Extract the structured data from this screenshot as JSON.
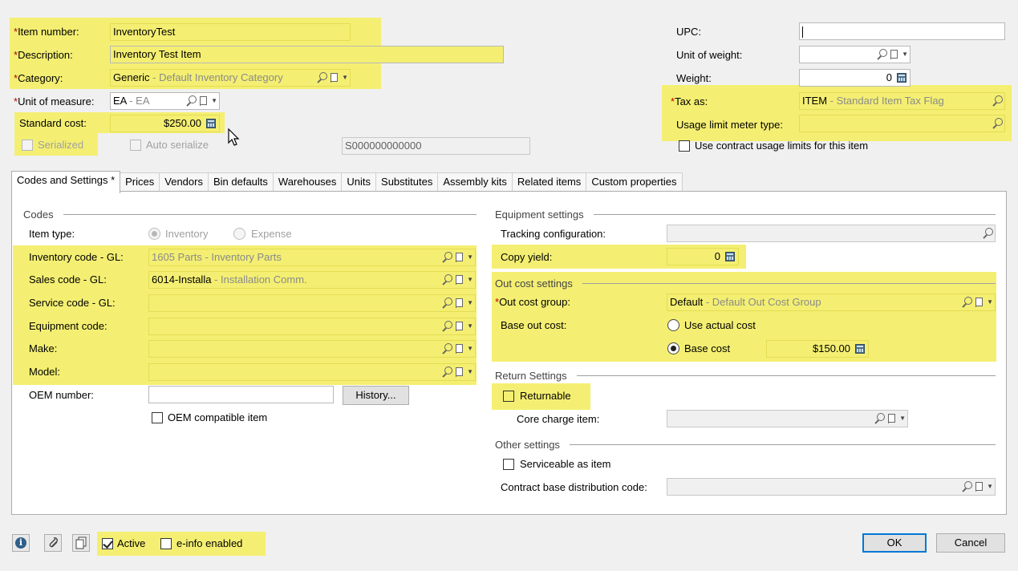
{
  "header": {
    "item_number": {
      "label": "Item number:",
      "value": "InventoryTest"
    },
    "description": {
      "label": "Description:",
      "value": "Inventory Test Item"
    },
    "category": {
      "label": "Category:",
      "value": "Generic",
      "sub": " - Default Inventory Category"
    },
    "unit_of_measure": {
      "label": "Unit of measure:",
      "value": "EA",
      "sub": " - EA"
    },
    "standard_cost": {
      "label": "Standard cost:",
      "value": "$250.00"
    },
    "serialized": {
      "label": "Serialized",
      "checked": false
    },
    "auto_serialize": {
      "label": "Auto serialize",
      "checked": false
    },
    "serial_value": "S000000000000",
    "upc": {
      "label": "UPC:",
      "value": ""
    },
    "unit_of_weight": {
      "label": "Unit of weight:",
      "value": ""
    },
    "weight": {
      "label": "Weight:",
      "value": "0"
    },
    "tax_as": {
      "label": "Tax as:",
      "value": "ITEM",
      "sub": " - Standard Item Tax Flag"
    },
    "usage_limit_meter_type": {
      "label": "Usage limit meter type:",
      "value": ""
    },
    "contract_usage": {
      "label": "Use contract usage limits for this item",
      "checked": false
    }
  },
  "tabs": [
    {
      "label": "Codes and Settings *",
      "active": true
    },
    {
      "label": "Prices"
    },
    {
      "label": "Vendors"
    },
    {
      "label": "Bin defaults"
    },
    {
      "label": "Warehouses"
    },
    {
      "label": "Units"
    },
    {
      "label": "Substitutes"
    },
    {
      "label": "Assembly kits"
    },
    {
      "label": "Related items"
    },
    {
      "label": "Custom properties"
    }
  ],
  "codes": {
    "title": "Codes",
    "item_type_label": "Item type:",
    "item_type_options": [
      "Inventory",
      "Expense"
    ],
    "item_type_selected": "Inventory",
    "inventory_code": {
      "label": "Inventory code - GL:",
      "value": "1605 Parts",
      "sub": " - Inventory Parts"
    },
    "sales_code": {
      "label": "Sales code - GL:",
      "value": "6014-Installa",
      "sub": " - Installation Comm."
    },
    "service_code": {
      "label": "Service code - GL:",
      "value": ""
    },
    "equipment_code": {
      "label": "Equipment code:",
      "value": ""
    },
    "make": {
      "label": "Make:",
      "value": ""
    },
    "model": {
      "label": "Model:",
      "value": ""
    },
    "oem_number": {
      "label": "OEM number:",
      "value": ""
    },
    "history_button": "History...",
    "oem_compatible": {
      "label": "OEM compatible item",
      "checked": false
    }
  },
  "equipment": {
    "title": "Equipment settings",
    "tracking_configuration": {
      "label": "Tracking configuration:",
      "value": ""
    },
    "copy_yield": {
      "label": "Copy yield:",
      "value": "0"
    }
  },
  "out_cost": {
    "title": "Out cost settings",
    "out_cost_group": {
      "label": "Out cost group:",
      "value": "Default",
      "sub": " - Default Out Cost Group"
    },
    "base_out_cost_label": "Base out cost:",
    "use_actual_cost": "Use actual cost",
    "base_cost": "Base cost",
    "base_cost_value": "$150.00",
    "selected": "Base cost"
  },
  "return_settings": {
    "title": "Return Settings",
    "returnable": {
      "label": "Returnable",
      "checked": false
    },
    "core_charge_item": {
      "label": "Core charge item:",
      "value": ""
    }
  },
  "other_settings": {
    "title": "Other settings",
    "serviceable_as_item": {
      "label": "Serviceable as item",
      "checked": false
    },
    "contract_base_distribution_code": {
      "label": "Contract base distribution code:",
      "value": ""
    }
  },
  "footer": {
    "active": {
      "label": "Active",
      "checked": true
    },
    "einfo": {
      "label": "e-info enabled",
      "checked": false
    },
    "ok": "OK",
    "cancel": "Cancel"
  },
  "colors": {
    "highlight": "#f4ef72",
    "required": "#c00000",
    "default_button_border": "#0078d7"
  }
}
